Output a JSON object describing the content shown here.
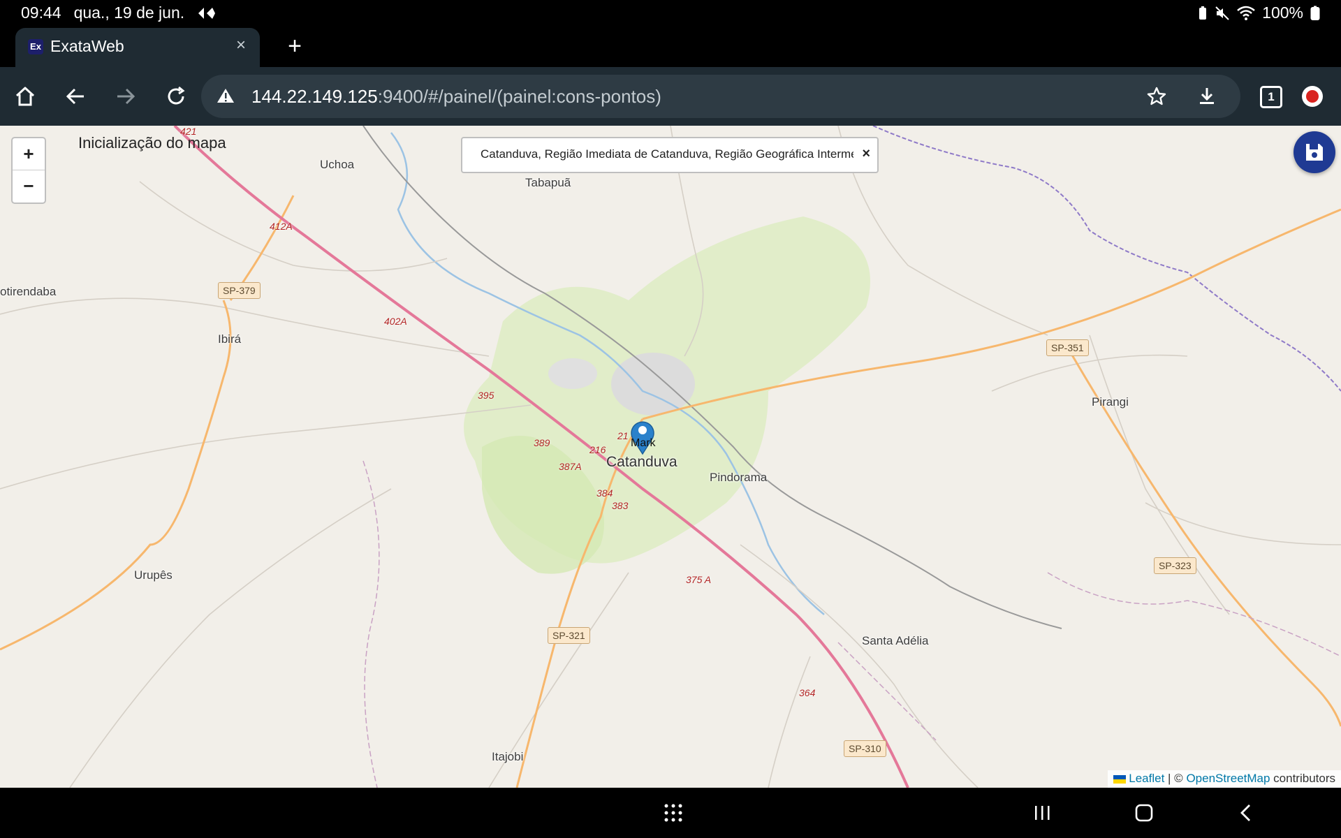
{
  "status": {
    "time": "09:44",
    "date": "qua., 19 de jun.",
    "battery": "100%"
  },
  "tab": {
    "favicon": "Ex",
    "title": "ExataWeb",
    "close": "×"
  },
  "newtab": "+",
  "address": {
    "host": "144.22.149.125",
    "path": ":9400/#/painel/(painel:cons-pontos)"
  },
  "toolbar": {
    "tab_count": "1"
  },
  "map": {
    "init_label": "Inicialização do mapa",
    "zoom_in": "+",
    "zoom_out": "−",
    "search_text": "Catanduva, Região Imediata de Catanduva, Região Geográfica Intermediária de São José do Rio Preto, São Paulo, Brasil",
    "search_clear": "×",
    "marker_label": "Mark",
    "places": {
      "uchoa": "Uchoa",
      "tabapua": "Tabapuã",
      "potirendaba": "otirendaba",
      "ibira": "Ibirá",
      "catanduva": "Catanduva",
      "pindorama": "Pindorama",
      "pirangi": "Pirangi",
      "urupes": "Urupês",
      "santa_adelia": "Santa Adélia",
      "itajobi": "Itajobi"
    },
    "shields": {
      "sp379": "SP-379",
      "sp351": "SP-351",
      "sp323": "SP-323",
      "sp321": "SP-321",
      "sp310": "SP-310"
    },
    "roads": {
      "r421": "421",
      "r412a": "412A",
      "r402a": "402A",
      "r395": "395",
      "r389": "389",
      "r387a": "387A",
      "r216": "216",
      "r21": "21",
      "r384": "384",
      "r383": "383",
      "r375a": "375 A",
      "r364": "364"
    },
    "attribution": {
      "leaflet": "Leaflet",
      "sep": " | © ",
      "osm": "OpenStreetMap",
      "contrib": " contributors"
    }
  }
}
